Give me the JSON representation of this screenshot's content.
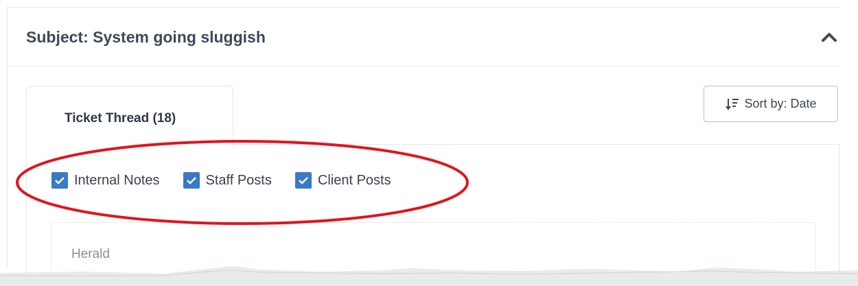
{
  "ticket": {
    "subject": "Subject: System going sluggish"
  },
  "tabs": [
    {
      "label": "Ticket Thread (18)",
      "active": true
    }
  ],
  "sort": {
    "label": "Sort by: Date",
    "icon": "sort-descending-icon"
  },
  "filters": [
    {
      "label": "Internal Notes",
      "checked": true
    },
    {
      "label": "Staff Posts",
      "checked": true
    },
    {
      "label": "Client Posts",
      "checked": true
    }
  ],
  "thread": {
    "first_author": "Herald"
  },
  "colors": {
    "checkbox": "#3a79c4",
    "annotation": "#e0141e",
    "title_text": "#3e4859"
  }
}
